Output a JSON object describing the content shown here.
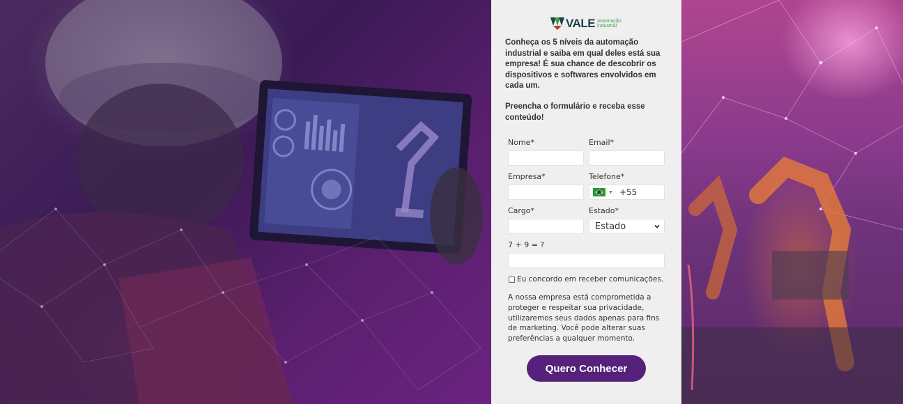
{
  "brand": {
    "name": "VALE",
    "tagline_line1": "automação",
    "tagline_line2": "industrial",
    "colors": {
      "dark": "#1f3f4a",
      "green": "#3aa04a",
      "accent": "#55217a"
    }
  },
  "intro": {
    "text": "Conheça os 5 níveis da automação industrial e saiba em qual deles está sua empresa! É sua chance de descobrir os dispositivos e softwares envolvidos em cada um.",
    "cta": "Preencha o formulário e receba esse conteúdo!"
  },
  "form": {
    "nome": {
      "label": "Nome*",
      "value": ""
    },
    "email": {
      "label": "Email*",
      "value": ""
    },
    "empresa": {
      "label": "Empresa*",
      "value": ""
    },
    "telefone": {
      "label": "Telefone*",
      "dial_code": "+55",
      "flag": "brazil-flag-icon"
    },
    "cargo": {
      "label": "Cargo*",
      "value": ""
    },
    "estado": {
      "label": "Estado*",
      "selected": "Estado"
    },
    "captcha": {
      "label": "7 + 9 = ?",
      "value": ""
    },
    "consent": {
      "label": "Eu concordo em receber comunicações.",
      "checked": false
    },
    "privacy": "A nossa empresa está comprometida a proteger e respeitar sua privacidade, utilizaremos seus dados apenas para fins de marketing. Você pode alterar suas preferências a qualquer momento.",
    "submit_label": "Quero Conhecer"
  }
}
